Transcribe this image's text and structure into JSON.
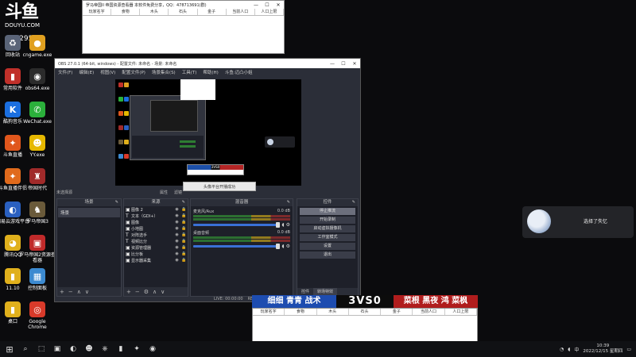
{
  "desktop": {
    "logo_big": "斗鱼",
    "logo_small": "DOUYU.COM",
    "viewer_count": "100295",
    "icons": [
      {
        "label": "回收站",
        "glyph": "♻",
        "color": "#5a6478"
      },
      {
        "label": "cngame.exe",
        "glyph": "●",
        "color": "#e0a020"
      },
      {
        "label": "常用软件",
        "glyph": "▮",
        "color": "#c0302a"
      },
      {
        "label": "obs64.exe",
        "glyph": "◉",
        "color": "#2b2b2b"
      },
      {
        "label": "酷狗音乐",
        "glyph": "K",
        "color": "#1b6fe0"
      },
      {
        "label": "WeChat.exe",
        "glyph": "✆",
        "color": "#2bb03b"
      },
      {
        "label": "斗鱼直播",
        "glyph": "✦",
        "color": "#e0561c"
      },
      {
        "label": "YY.exe",
        "glyph": "☻",
        "color": "#e6b800"
      },
      {
        "label": "斗鱼直播伴侣",
        "glyph": "✦",
        "color": "#e06a1c"
      },
      {
        "label": "帝国时代",
        "glyph": "♜",
        "color": "#a02a2a"
      },
      {
        "label": "网易云游戏平台",
        "glyph": "◐",
        "color": "#2a60c0"
      },
      {
        "label": "罗马帝国3",
        "glyph": "♞",
        "color": "#6a5a3a"
      },
      {
        "label": "腾讯QQ",
        "glyph": "◕",
        "color": "#e0b01c"
      },
      {
        "label": "罗马帝国2资源查看器",
        "glyph": "▣",
        "color": "#c02a2a"
      },
      {
        "label": "11.10",
        "glyph": "▮",
        "color": "#e0b01c"
      },
      {
        "label": "控制面板",
        "glyph": "▦",
        "color": "#3c8ad0"
      },
      {
        "label": "桌口",
        "glyph": "▮",
        "color": "#e0b01c"
      },
      {
        "label": "Google Chrome",
        "glyph": "◎",
        "color": "#d83a2a"
      }
    ]
  },
  "top_window": {
    "title": "罗马帝国II 帝国资源查看器    本软件免费分享，QQ：478713691(群)",
    "columns": [
      "玩家名字",
      "食物",
      "木头",
      "石头",
      "金子",
      "当前人口",
      "人口上限"
    ]
  },
  "bottom_window": {
    "columns": [
      "玩家名字",
      "食物",
      "木头",
      "石头",
      "金子",
      "当前人口",
      "人口上限"
    ]
  },
  "obs": {
    "title": "OBS 27.0.1 (64-bit, windows) - 配置文件: 未命名 - 场景: 未命名",
    "menu": [
      "文件(F)",
      "编辑(E)",
      "视图(V)",
      "配置文件(P)",
      "场景集合(S)",
      "工具(T)",
      "帮助(H)",
      "斗鱼:迈凸小姐"
    ],
    "status_left": "未选择源",
    "status_mid1": "属性",
    "status_mid2": "滤镜",
    "preview_notice": "头像平台开播成功",
    "docks": {
      "scenes_title": "场景",
      "sources_title": "来源",
      "mixer_title": "混音器",
      "controls_title": "控件"
    },
    "scenes": [
      "场景"
    ],
    "sources": [
      {
        "type": "▣",
        "label": "图像 2"
      },
      {
        "type": "T",
        "label": "文本（GDI+）"
      },
      {
        "type": "▣",
        "label": "图像"
      },
      {
        "type": "▣",
        "label": "小地图"
      },
      {
        "type": "T",
        "label": "对阵选手"
      },
      {
        "type": "T",
        "label": "视频比分"
      },
      {
        "type": "▣",
        "label": "资源管理器"
      },
      {
        "type": "▣",
        "label": "比分板"
      },
      {
        "type": "▣",
        "label": "显示器采集"
      }
    ],
    "mixer": [
      {
        "name": "麦克风/Aux",
        "db": "0.0 dB"
      },
      {
        "name": "桌面音频",
        "db": "0.0 dB"
      }
    ],
    "controls": [
      "停止推流",
      "开始录制",
      "启动虚拟摄像机",
      "工作室模式",
      "设置",
      "退出"
    ],
    "control_tabs": [
      "控件",
      "转场特效"
    ],
    "status_right": [
      "LIVE: 00:00:00",
      "REC: 00:00:00",
      "CPU: 7.1%, 30.00 fps"
    ]
  },
  "score_banner": {
    "blue_team": "细细 青青 战术",
    "score": "3VS0",
    "red_team": "菜根 黑夜 鸿 菜枫"
  },
  "notification": {
    "text": "选择了失忆"
  },
  "taskbar": {
    "start_glyph": "⊞",
    "items": [
      "⌕",
      "⬚",
      "▣",
      "◐",
      "☻",
      "⎈",
      "▮",
      "✦",
      "◉"
    ],
    "tray_lang": "中",
    "time": "10:39",
    "date": "2022/12/15 星期四"
  }
}
